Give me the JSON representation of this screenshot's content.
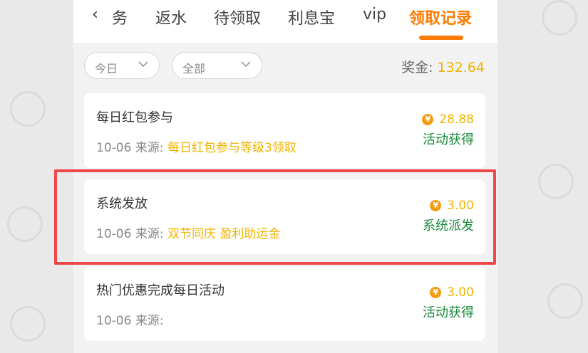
{
  "tabs": {
    "back_icon": "chevron-left-icon",
    "items": [
      "务",
      "返水",
      "待领取",
      "利息宝",
      "vip",
      "领取记录"
    ],
    "active_index": 5
  },
  "filters": {
    "date": "今日",
    "type": "全部"
  },
  "bonus": {
    "label": "奖金:",
    "amount": "132.64"
  },
  "records": [
    {
      "title": "每日红包参与",
      "date": "10-06",
      "source_label": "来源:",
      "source": "每日红包参与等级3领取",
      "amount": "28.88",
      "status": "活动获得"
    },
    {
      "title": "系统发放",
      "date": "10-06",
      "source_label": "来源:",
      "source": "双节同庆 盈利助运金",
      "amount": "3.00",
      "status": "系统派发"
    },
    {
      "title": "热门优惠完成每日活动",
      "date": "10-06",
      "source_label": "来源:",
      "source": "",
      "amount": "3.00",
      "status": "活动获得"
    }
  ],
  "coin_glyph": "¥",
  "colors": {
    "accent": "#ff7a00",
    "gold": "#f0b400",
    "status_green": "#1a8a3a",
    "highlight_red": "#f04848"
  }
}
